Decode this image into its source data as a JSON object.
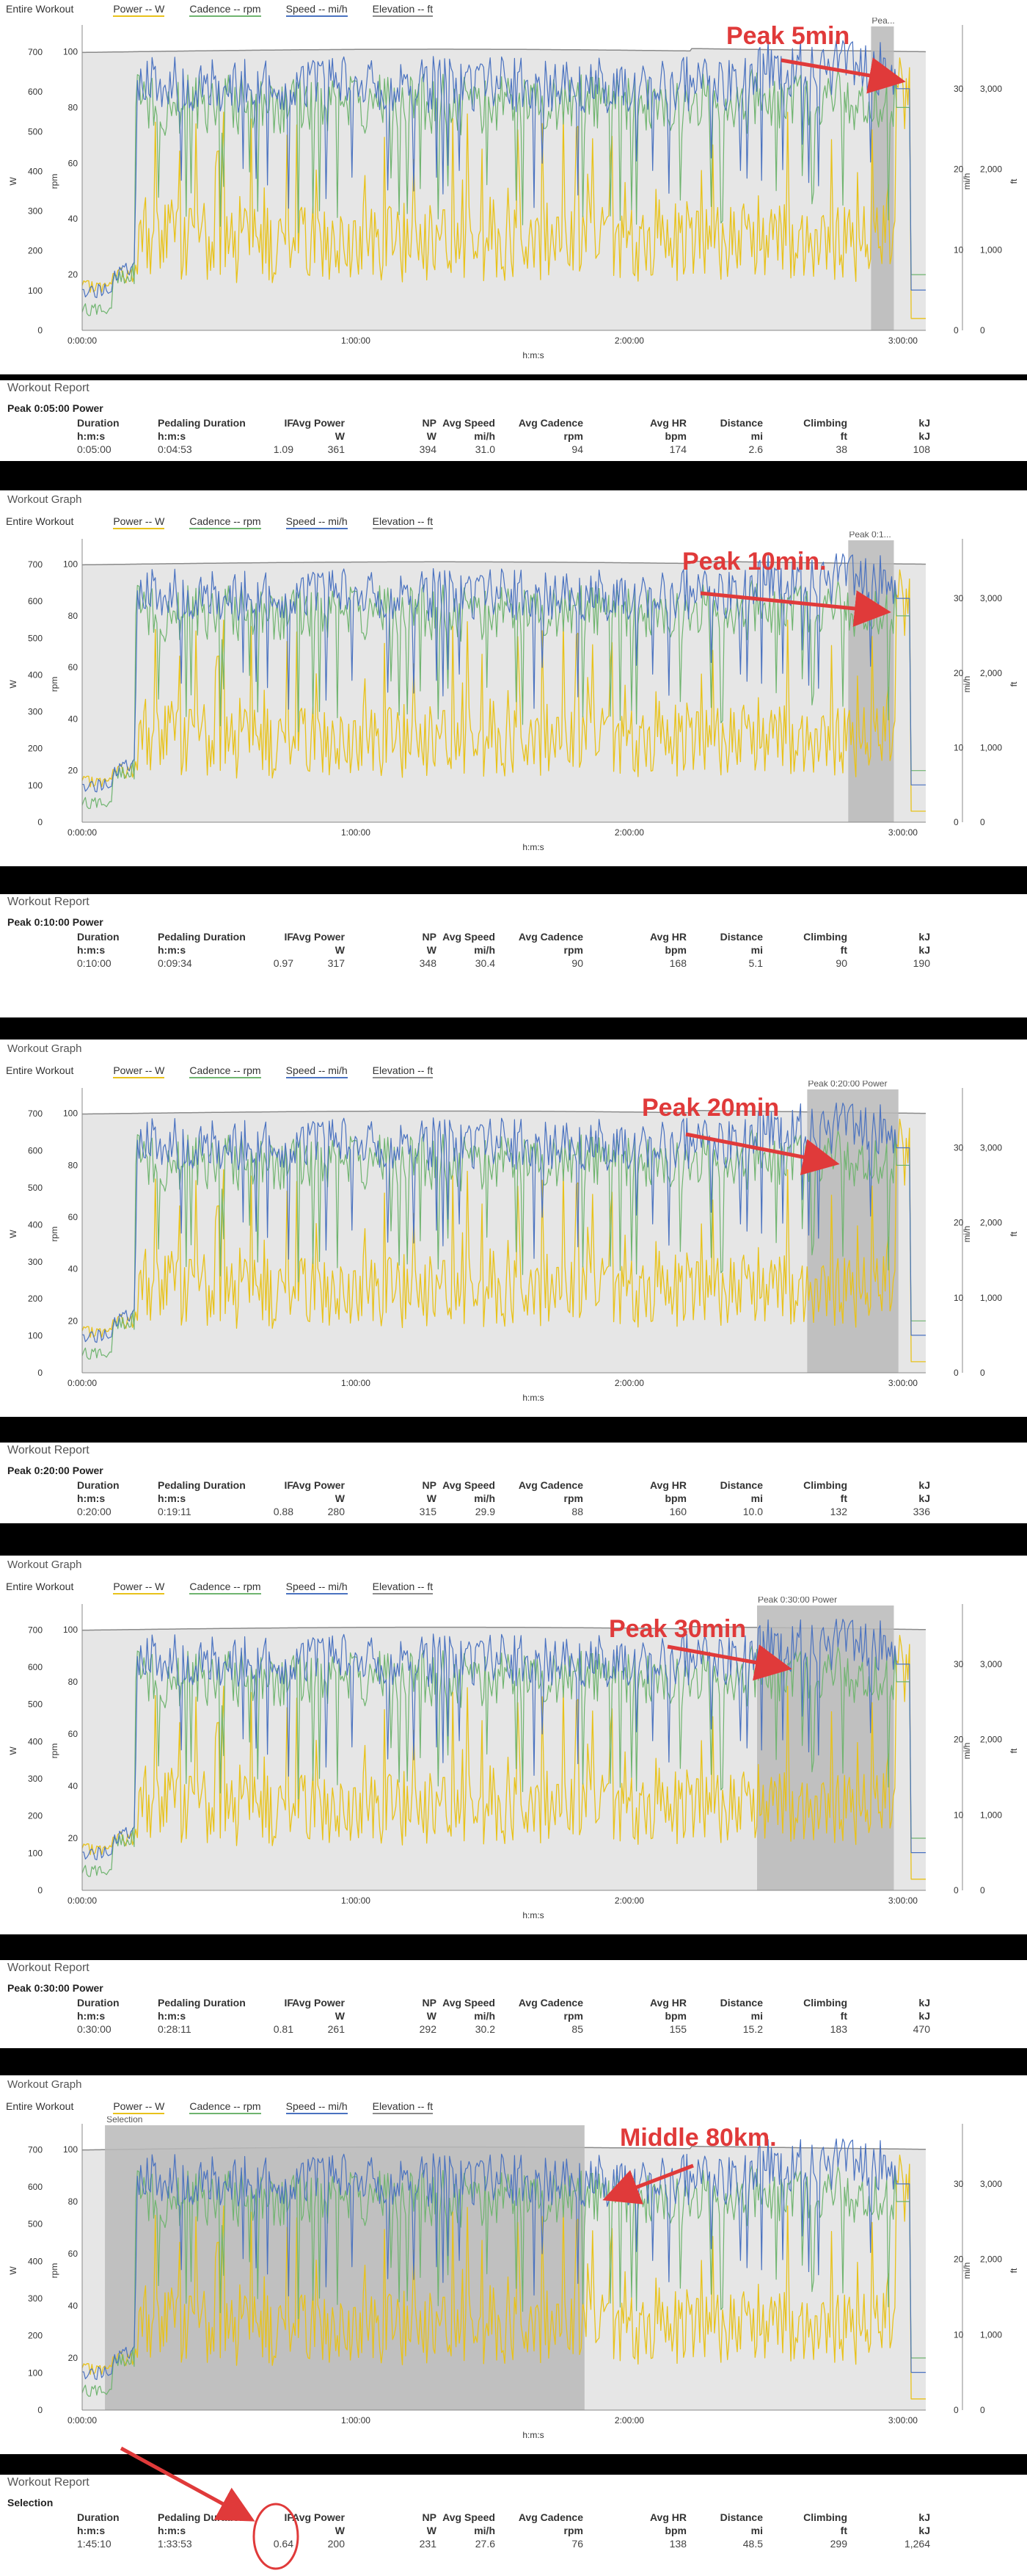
{
  "legend": {
    "entire_workout": "Entire Workout",
    "power": "Power -- W",
    "cadence": "Cadence -- rpm",
    "speed": "Speed -- mi/h",
    "elevation": "Elevation -- ft"
  },
  "graph_title": "Workout Graph",
  "report_title": "Workout Report",
  "columns": {
    "duration": [
      "Duration",
      "h:m:s"
    ],
    "pedaling": [
      "Pedaling Duration",
      "h:m:s"
    ],
    "if": [
      "IF",
      ""
    ],
    "avg_power": [
      "Avg Power",
      "W"
    ],
    "np": [
      "NP",
      "W"
    ],
    "avg_speed": [
      "Avg Speed",
      "mi/h"
    ],
    "avg_cadence": [
      "Avg Cadence",
      "rpm"
    ],
    "avg_hr": [
      "Avg HR",
      "bpm"
    ],
    "distance": [
      "Distance",
      "mi"
    ],
    "climbing": [
      "Climbing",
      "ft"
    ],
    "kj": [
      "kJ",
      "kJ"
    ]
  },
  "colors": {
    "power": "#e8c21a",
    "cadence": "#6fb46f",
    "speed": "#4a72c0",
    "elevation": "#8a8a8a",
    "plot_bg": "#e6e6e6",
    "selection": "#b9b9b9",
    "annotation": "#e03a3a"
  },
  "chart_data": [
    {
      "type": "line",
      "panel_title": "",
      "selection_label": "Pea...",
      "selection_range": [
        "2:53:00",
        "2:58:00"
      ],
      "annotation": "Peak 5min",
      "report_subtitle": "Peak 0:05:00 Power",
      "report_values": {
        "duration": "0:05:00",
        "pedaling": "0:04:53",
        "if": "1.09",
        "avg_power": "361",
        "np": "394",
        "avg_speed": "31.0",
        "avg_cadence": "94",
        "avg_hr": "174",
        "distance": "2.6",
        "climbing": "38",
        "kj": "108"
      }
    },
    {
      "type": "line",
      "panel_title": "Workout Graph",
      "selection_label": "Peak 0:1...",
      "selection_range": [
        "2:48:00",
        "2:58:00"
      ],
      "annotation": "Peak 10min.",
      "report_subtitle": "Peak 0:10:00 Power",
      "report_values": {
        "duration": "0:10:00",
        "pedaling": "0:09:34",
        "if": "0.97",
        "avg_power": "317",
        "np": "348",
        "avg_speed": "30.4",
        "avg_cadence": "90",
        "avg_hr": "168",
        "distance": "5.1",
        "climbing": "90",
        "kj": "190"
      }
    },
    {
      "type": "line",
      "panel_title": "Workout Graph",
      "selection_label": "Peak 0:20:00 Power",
      "selection_range": [
        "2:39:00",
        "2:59:00"
      ],
      "annotation": "Peak 20min",
      "report_subtitle": "Peak 0:20:00 Power",
      "report_values": {
        "duration": "0:20:00",
        "pedaling": "0:19:11",
        "if": "0.88",
        "avg_power": "280",
        "np": "315",
        "avg_speed": "29.9",
        "avg_cadence": "88",
        "avg_hr": "160",
        "distance": "10.0",
        "climbing": "132",
        "kj": "336"
      }
    },
    {
      "type": "line",
      "panel_title": "Workout Graph",
      "selection_label": "Peak 0:30:00 Power",
      "selection_range": [
        "2:28:00",
        "2:58:00"
      ],
      "annotation": "Peak 30min",
      "report_subtitle": "Peak 0:30:00 Power",
      "report_values": {
        "duration": "0:30:00",
        "pedaling": "0:28:11",
        "if": "0.81",
        "avg_power": "261",
        "np": "292",
        "avg_speed": "30.2",
        "avg_cadence": "85",
        "avg_hr": "155",
        "distance": "15.2",
        "climbing": "183",
        "kj": "470"
      }
    },
    {
      "type": "line",
      "panel_title": "Workout Graph",
      "selection_label": "Selection",
      "selection_range": [
        "0:05:00",
        "1:50:10"
      ],
      "annotation": "Middle 80km.",
      "report_subtitle": "Selection",
      "report_values": {
        "duration": "1:45:10",
        "pedaling": "1:33:53",
        "if": "0.64",
        "avg_power": "200",
        "np": "231",
        "avg_speed": "27.6",
        "avg_cadence": "76",
        "avg_hr": "138",
        "distance": "48.5",
        "climbing": "299",
        "kj": "1,264"
      }
    }
  ],
  "axes": {
    "x_label": "h:m:s",
    "x_ticks": [
      "0:00:00",
      "1:00:00",
      "2:00:00",
      "3:00:00"
    ],
    "watts_label": "W",
    "watts_ticks": [
      "0",
      "100",
      "200",
      "300",
      "400",
      "500",
      "600",
      "700"
    ],
    "rpm_label": "rpm",
    "rpm_ticks": [
      "20",
      "40",
      "60",
      "80",
      "100"
    ],
    "speed_label": "mi/h",
    "speed_ticks": [
      "0",
      "10",
      "20",
      "30"
    ],
    "elev_label": "ft",
    "elev_ticks": [
      "0",
      "1,000",
      "2,000",
      "3,000"
    ],
    "x_range_seconds": [
      0,
      11100
    ],
    "watts_range": [
      0,
      750
    ],
    "rpm_range": [
      0,
      107
    ],
    "speed_range": [
      0,
      37
    ],
    "elev_range": [
      0,
      3700
    ]
  }
}
